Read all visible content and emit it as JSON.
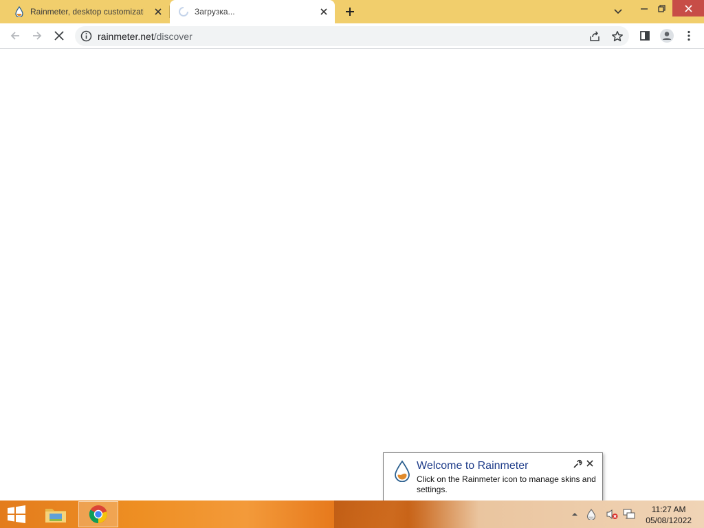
{
  "browser": {
    "tabs": [
      {
        "title": "Rainmeter, desktop customization tool",
        "active": false,
        "favicon": "rainmeter-drop-icon"
      },
      {
        "title": "Загрузка...",
        "active": true,
        "favicon": "loading-spinner-icon"
      }
    ],
    "address_bar": {
      "domain": "rainmeter.net",
      "path": "/discover"
    }
  },
  "balloon": {
    "title": "Welcome to Rainmeter",
    "message": "Click on the Rainmeter icon to manage skins and settings."
  },
  "taskbar": {
    "clock_time": "11:27 AM",
    "clock_date": "05/08/12022"
  },
  "colors": {
    "tabstrip": "#f1ce6c",
    "balloon_title": "#1f3d8a",
    "close_button": "#c74d47"
  }
}
